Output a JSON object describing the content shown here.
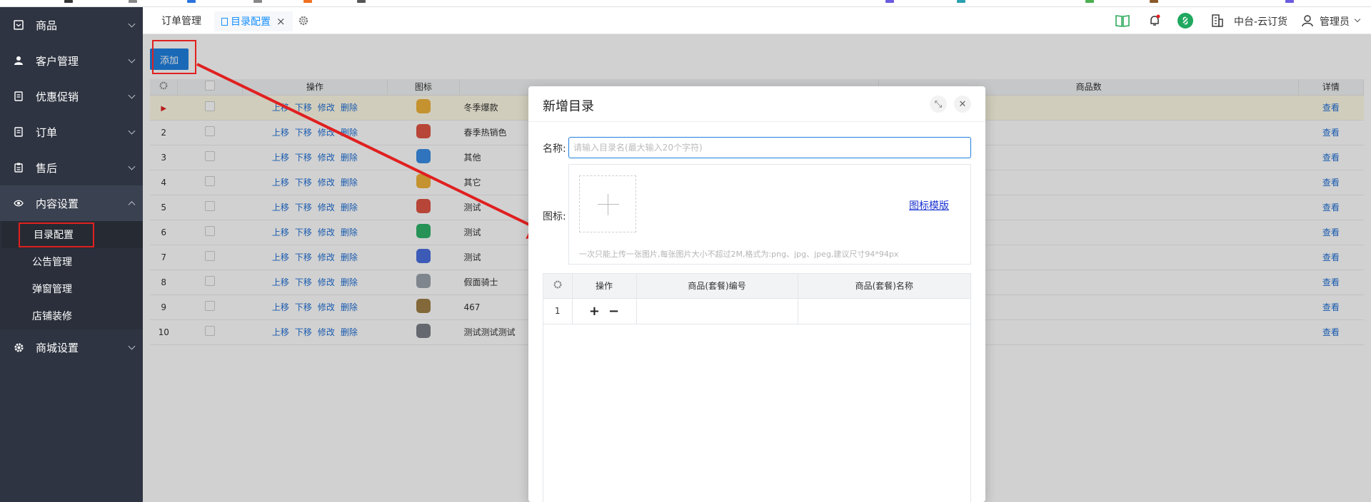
{
  "sidebar": {
    "items": [
      {
        "label": "商品",
        "icon": "product-icon"
      },
      {
        "label": "客户管理",
        "icon": "user-icon"
      },
      {
        "label": "优惠促销",
        "icon": "promo-icon"
      },
      {
        "label": "订单",
        "icon": "order-icon"
      },
      {
        "label": "售后",
        "icon": "aftersale-icon"
      },
      {
        "label": "内容设置",
        "icon": "eye-icon"
      },
      {
        "label": "商城设置",
        "icon": "gear-icon"
      }
    ],
    "submenu": [
      "目录配置",
      "公告管理",
      "弹窗管理",
      "店铺装修"
    ]
  },
  "tabs": [
    {
      "label": "订单管理"
    },
    {
      "label": "目录配置"
    }
  ],
  "header": {
    "org": "中台-云订货",
    "user": "管理员"
  },
  "toolbar": {
    "add_label": "添加"
  },
  "grid": {
    "headers": {
      "ops": "操作",
      "icon": "图标",
      "count": "商品数",
      "detail": "详情"
    },
    "ops": [
      "上移",
      "下移",
      "修改",
      "删除"
    ],
    "view": "查看",
    "rows": [
      {
        "no": "",
        "name": "冬季爆款",
        "color": "#f0b33a"
      },
      {
        "no": "2",
        "name": "春季热销色",
        "color": "#e05545"
      },
      {
        "no": "3",
        "name": "其他",
        "color": "#3a8ee6"
      },
      {
        "no": "4",
        "name": "其它",
        "color": "#f0b33a"
      },
      {
        "no": "5",
        "name": "测试",
        "color": "#e05545"
      },
      {
        "no": "6",
        "name": "测试",
        "color": "#2fb36a"
      },
      {
        "no": "7",
        "name": "测试",
        "color": "#4a6fe0"
      },
      {
        "no": "8",
        "name": "假面骑士",
        "color": "#9aa3ad"
      },
      {
        "no": "9",
        "name": "467",
        "color": "#a08046"
      },
      {
        "no": "10",
        "name": "测试测试测试",
        "color": "#7c8088"
      }
    ]
  },
  "modal": {
    "title": "新增目录",
    "name_label": "名称:",
    "name_placeholder": "请输入目录名(最大输入20个字符)",
    "icon_label": "图标:",
    "template_link": "图标模版",
    "hint": "一次只能上传一张图片,每张图片大小不超过2M,格式为:png、jpg、jpeg,建议尺寸94*94px",
    "table": {
      "headers": [
        "操作",
        "商品(套餐)编号",
        "商品(套餐)名称"
      ],
      "rows": [
        {
          "no": "1",
          "code": "",
          "name": ""
        }
      ]
    }
  }
}
